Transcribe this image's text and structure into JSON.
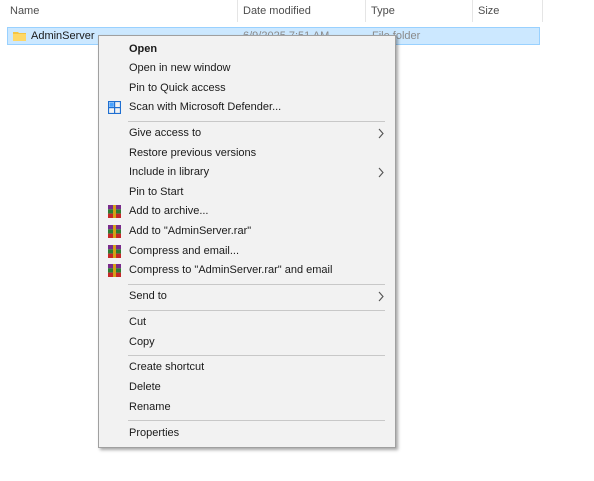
{
  "columns": {
    "name": "Name",
    "date_modified": "Date modified",
    "type": "Type",
    "size": "Size"
  },
  "file": {
    "name": "AdminServer",
    "date": "6/9/2025 7:51 AM",
    "type": "File folder",
    "icon": "folder-icon"
  },
  "menu": {
    "open": "Open",
    "open_new_window": "Open in new window",
    "pin_quick_access": "Pin to Quick access",
    "scan_defender": "Scan with Microsoft Defender...",
    "give_access": "Give access to",
    "restore_versions": "Restore previous versions",
    "include_library": "Include in library",
    "pin_start": "Pin to Start",
    "add_archive": "Add to archive...",
    "add_rar": "Add to \"AdminServer.rar\"",
    "compress_email": "Compress and email...",
    "compress_rar_email": "Compress to \"AdminServer.rar\" and email",
    "send_to": "Send to",
    "cut": "Cut",
    "copy": "Copy",
    "create_shortcut": "Create shortcut",
    "delete": "Delete",
    "rename": "Rename",
    "properties": "Properties"
  },
  "colors": {
    "selection_bg": "#cce8ff",
    "selection_border": "#99d1ff",
    "menu_bg": "#f2f2f2",
    "defender_blue": "#1f6fd1",
    "folder_yellow": "#f5c542"
  }
}
